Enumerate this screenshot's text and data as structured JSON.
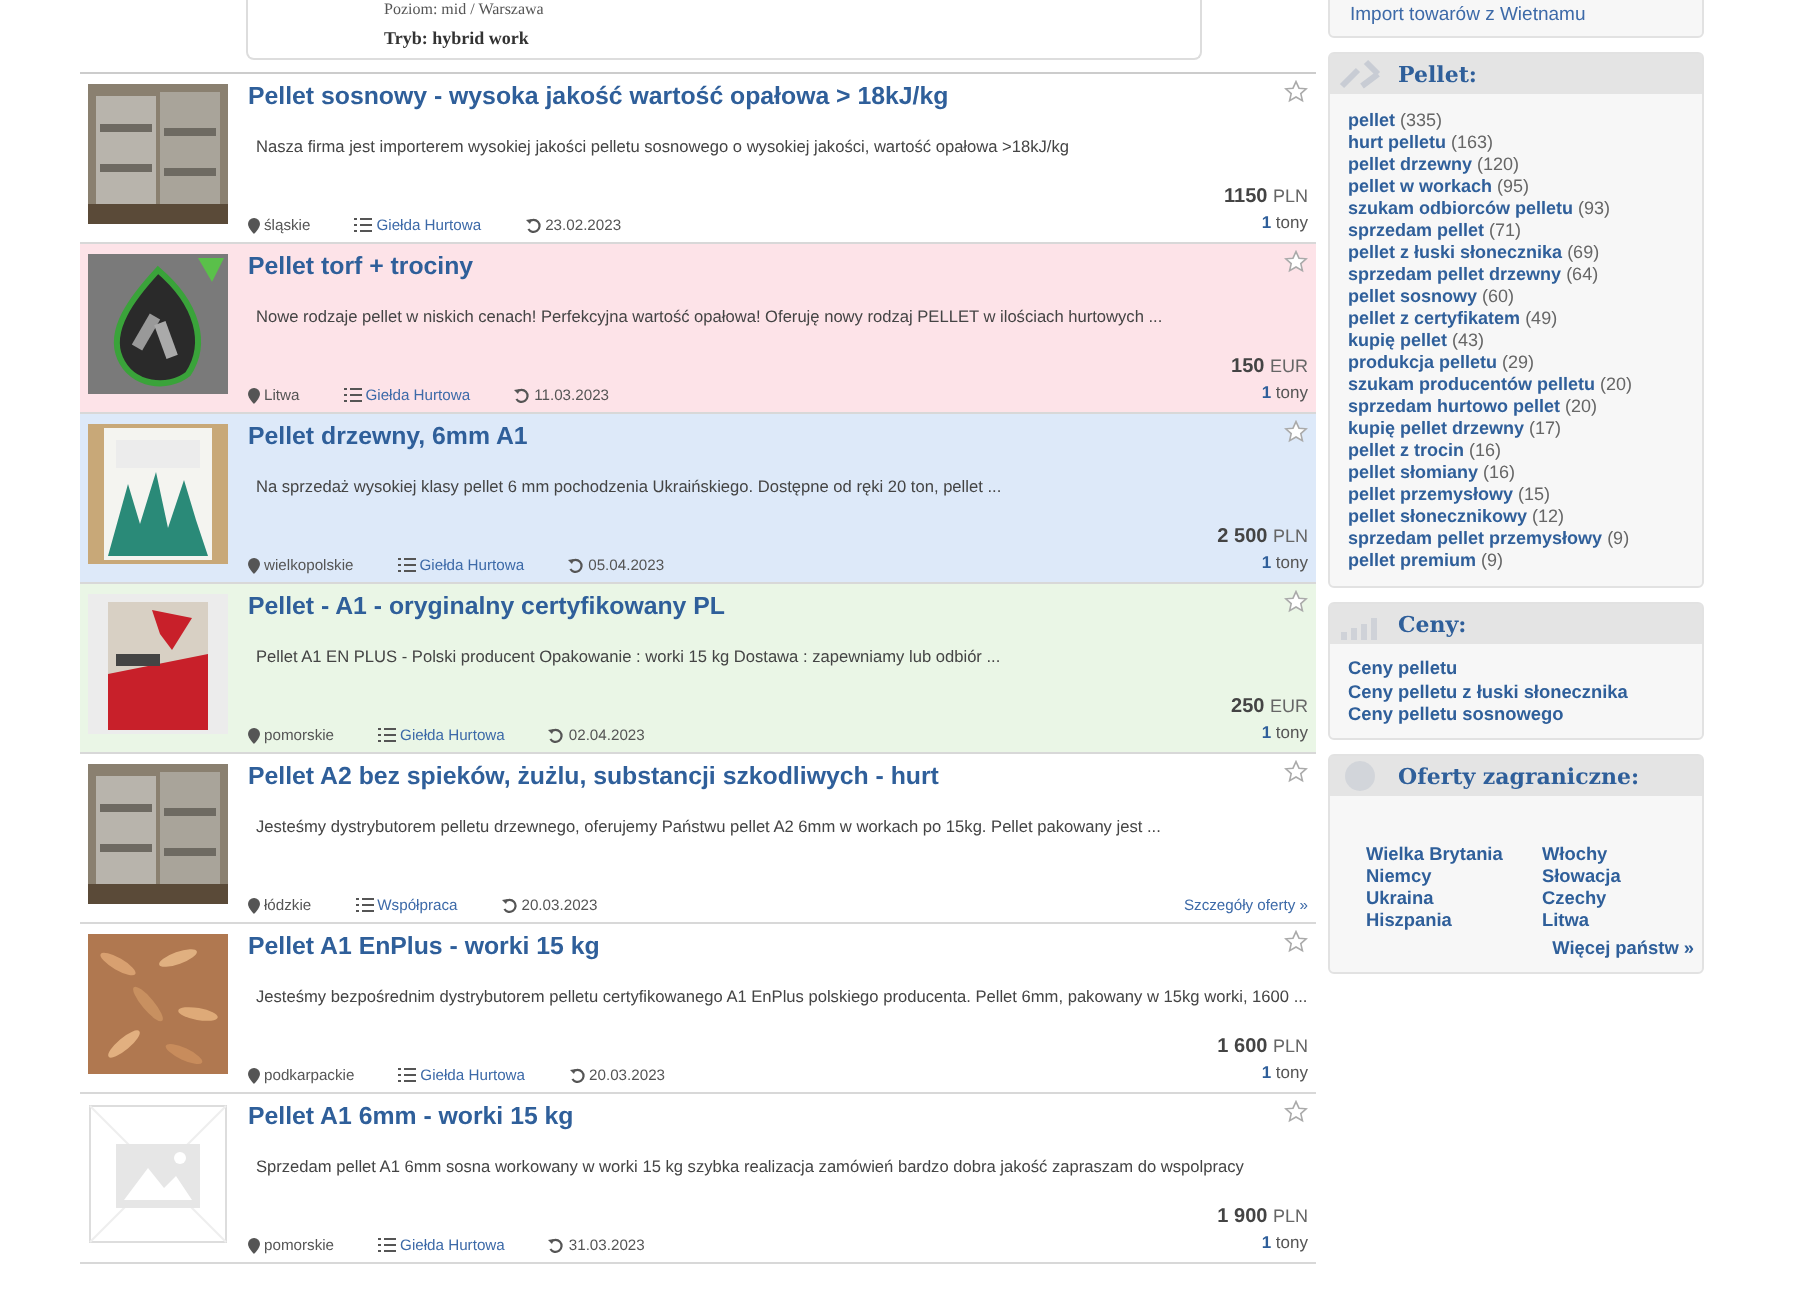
{
  "top_card": {
    "level_line": "Poziom: mid / Warszawa",
    "mode_line": "Tryb: hybrid work"
  },
  "listings": [
    {
      "title": "Pellet sosnowy - wysoka jakość wartość opałowa > 18kJ/kg",
      "description": "Nasza firma jest importerem wysokiej jakości pelletu sosnowego o wysokiej jakości, wartość opałowa >18kJ/kg",
      "region": "śląskie",
      "category": "Giełda Hurtowa",
      "date": "23.02.2023",
      "price": "1150",
      "currency": "PLN",
      "quantity": "1",
      "unit": "tony",
      "color": "#ffffff"
    },
    {
      "title": "Pellet torf + trociny",
      "description": "Nowe rodzaje pellet w niskich cenach! Perfekcyjna wartość opałowa! Oferuję nowy rodzaj PELLET w ilościach hurtowych ...",
      "region": "Litwa",
      "category": "Giełda Hurtowa",
      "date": "11.03.2023",
      "price": "150",
      "currency": "EUR",
      "quantity": "1",
      "unit": "tony",
      "color": "#fde3e8"
    },
    {
      "title": "Pellet drzewny, 6mm A1",
      "description": "Na sprzedaż wysokiej klasy pellet 6 mm pochodzenia Ukraińskiego. Dostępne od ręki 20 ton, pellet ...",
      "region": "wielkopolskie",
      "category": "Giełda Hurtowa",
      "date": "05.04.2023",
      "price": "2 500",
      "currency": "PLN",
      "quantity": "1",
      "unit": "tony",
      "color": "#dde9f9"
    },
    {
      "title": "Pellet - A1 - oryginalny certyfikowany PL",
      "description": "Pellet A1 EN PLUS - Polski producent Opakowanie : worki 15 kg Dostawa : zapewniamy lub odbiór ...",
      "region": "pomorskie",
      "category": "Giełda Hurtowa",
      "date": "02.04.2023",
      "price": "250",
      "currency": "EUR",
      "quantity": "1",
      "unit": "tony",
      "color": "#eaf6e6"
    },
    {
      "title": "Pellet A2 bez spieków, żużlu, substancji szkodliwych - hurt",
      "description": "Jesteśmy dystrybutorem pelletu drzewnego, oferujemy Państwu pellet A2 6mm w workach po 15kg. Pellet pakowany jest ...",
      "region": "łódzkie",
      "category": "Współpraca",
      "date": "20.03.2023",
      "details_link": "Szczegóły oferty »",
      "color": "#ffffff"
    },
    {
      "title": "Pellet A1 EnPlus - worki 15 kg",
      "description": "Jesteśmy bezpośrednim dystrybutorem pelletu certyfikowanego A1 EnPlus polskiego producenta. Pellet 6mm, pakowany w 15kg worki, 1600 ...",
      "region": "podkarpackie",
      "category": "Giełda Hurtowa",
      "date": "20.03.2023",
      "price": "1 600",
      "currency": "PLN",
      "quantity": "1",
      "unit": "tony",
      "color": "#ffffff"
    },
    {
      "title": "Pellet A1 6mm - worki 15 kg",
      "description": "Sprzedam pellet A1 6mm sosna workowany w worki 15 kg szybka realizacja zamówień bardzo dobra jakość zapraszam do wspolpracy",
      "region": "pomorskie",
      "category": "Giełda Hurtowa",
      "date": "31.03.2023",
      "price": "1 900",
      "currency": "PLN",
      "quantity": "1",
      "unit": "tony",
      "color": "#ffffff"
    }
  ],
  "sidebar": {
    "top_link": "Import towarów z Wietnamu",
    "pellet_panel": {
      "title": "Pellet:",
      "items": [
        {
          "label": "pellet",
          "count": "(335)"
        },
        {
          "label": "hurt pelletu",
          "count": "(163)"
        },
        {
          "label": "pellet drzewny",
          "count": "(120)"
        },
        {
          "label": "pellet w workach",
          "count": "(95)"
        },
        {
          "label": "szukam odbiorców pelletu",
          "count": "(93)"
        },
        {
          "label": "sprzedam pellet",
          "count": "(71)"
        },
        {
          "label": "pellet z łuski słonecznika",
          "count": "(69)"
        },
        {
          "label": "sprzedam pellet drzewny",
          "count": "(64)"
        },
        {
          "label": "pellet sosnowy",
          "count": "(60)"
        },
        {
          "label": "pellet z certyfikatem",
          "count": "(49)"
        },
        {
          "label": "kupię pellet",
          "count": "(43)"
        },
        {
          "label": "produkcja pelletu",
          "count": "(29)"
        },
        {
          "label": "szukam producentów pelletu",
          "count": "(20)"
        },
        {
          "label": "sprzedam hurtowo pellet",
          "count": "(20)"
        },
        {
          "label": "kupię pellet drzewny",
          "count": "(17)"
        },
        {
          "label": "pellet z trocin",
          "count": "(16)"
        },
        {
          "label": "pellet słomiany",
          "count": "(16)"
        },
        {
          "label": "pellet przemysłowy",
          "count": "(15)"
        },
        {
          "label": "pellet słonecznikowy",
          "count": "(12)"
        },
        {
          "label": "sprzedam pellet przemysłowy",
          "count": "(9)"
        },
        {
          "label": "pellet premium",
          "count": "(9)"
        }
      ]
    },
    "prices_panel": {
      "title": "Ceny:",
      "items": [
        "Ceny pelletu",
        "Ceny pelletu z łuski słonecznika",
        "Ceny pelletu sosnowego"
      ]
    },
    "foreign_panel": {
      "title": "Oferty zagraniczne:",
      "countries": [
        "Wielka Brytania",
        "Włochy",
        "Niemcy",
        "Słowacja",
        "Ukraina",
        "Czechy",
        "Hiszpania",
        "Litwa"
      ],
      "more_link": "Więcej państw »"
    }
  }
}
